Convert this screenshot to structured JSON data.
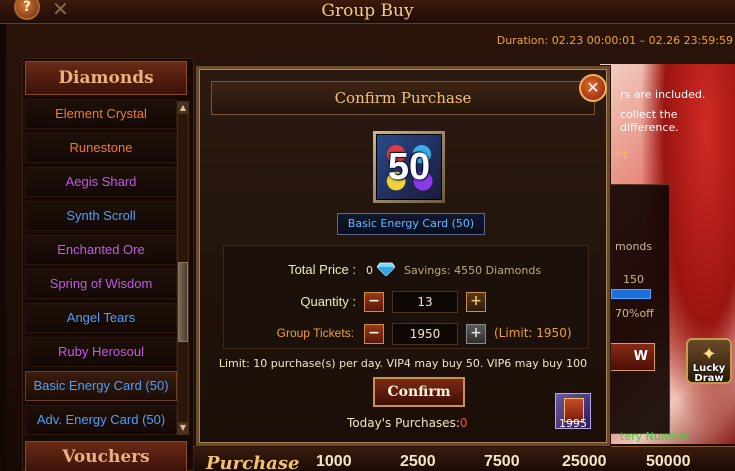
{
  "header": {
    "title": "Group Buy",
    "help_label": "?",
    "duration": "Duration: 02.23 00:00:01 – 02.26 23:59:59"
  },
  "sidebar": {
    "header": "Diamonds",
    "footer": "Vouchers",
    "items": [
      {
        "label": "Element Crystal",
        "color": "#f07a30"
      },
      {
        "label": "Runestone",
        "color": "#f07a30"
      },
      {
        "label": "Aegis Shard",
        "color": "#c05ae8"
      },
      {
        "label": "Synth Scroll",
        "color": "#4aa0ff"
      },
      {
        "label": "Enchanted Ore",
        "color": "#c05ae8"
      },
      {
        "label": "Spring of Wisdom",
        "color": "#c05ae8"
      },
      {
        "label": "Angel Tears",
        "color": "#4aa0ff"
      },
      {
        "label": "Ruby Herosoul",
        "color": "#c05ae8"
      },
      {
        "label": "Basic Energy Card (50)",
        "color": "#4aa0ff",
        "active": true
      },
      {
        "label": "Adv. Energy Card (50)",
        "color": "#4aa0ff"
      }
    ]
  },
  "background": {
    "text1": "rs are included.",
    "text2": "collect the difference.",
    "text3": "nt",
    "box_text1": "monds",
    "box_text2": "150",
    "box_text3": "70%off",
    "box_button": "W",
    "number_text": "tery Number",
    "lucky_draw": "Lucky Draw"
  },
  "purchase_bar": {
    "label": "Purchase",
    "tiers": [
      "1000",
      "2500",
      "7500",
      "25000",
      "50000"
    ]
  },
  "dialog": {
    "title": "Confirm Purchase",
    "close_label": "✕",
    "item_number": "50",
    "item_name": "Basic Energy Card (50)",
    "total_price_label": "Total Price :",
    "total_price_value": "0",
    "savings": "Savings: 4550 Diamonds",
    "quantity_label": "Quantity :",
    "quantity_value": "13",
    "tickets_label": "Group Tickets:",
    "tickets_value": "1950",
    "tickets_limit": "(Limit: 1950)",
    "limit_line": "Limit: 10 purchase(s) per day. VIP4 may buy 50. VIP6 may buy 100",
    "confirm_label": "Confirm",
    "today_label": "Today's Purchases:",
    "today_value": "0",
    "ticket_count": "1995"
  }
}
